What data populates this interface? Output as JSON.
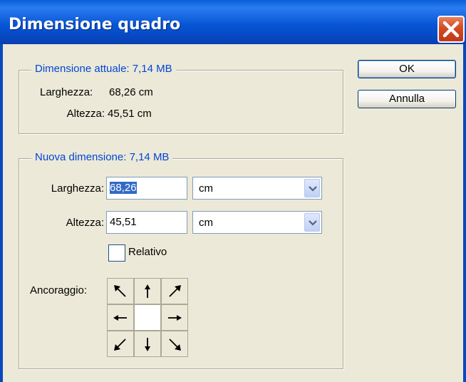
{
  "window": {
    "title": "Dimensione quadro"
  },
  "current_size": {
    "legend": "Dimensione attuale:  7,14 MB",
    "width_label": "Larghezza:",
    "width_value": "68,26 cm",
    "height_label": "Altezza:",
    "height_value": "45,51 cm"
  },
  "new_size": {
    "legend": "Nuova dimensione:  7,14 MB",
    "width_label": "Larghezza:",
    "width_value": "68,26",
    "width_unit": "cm",
    "height_label": "Altezza:",
    "height_value": "45,51",
    "height_unit": "cm",
    "relative_label": "Relativo",
    "relative_checked": false,
    "anchor_label": "Ancoraggio:",
    "anchor_selected": "center"
  },
  "buttons": {
    "ok": "OK",
    "cancel": "Annulla"
  },
  "colors": {
    "titlebar": "#0856d6",
    "legend_text": "#0046d5",
    "dialog_bg": "#ece9d8",
    "close_button": "#d64a22"
  }
}
